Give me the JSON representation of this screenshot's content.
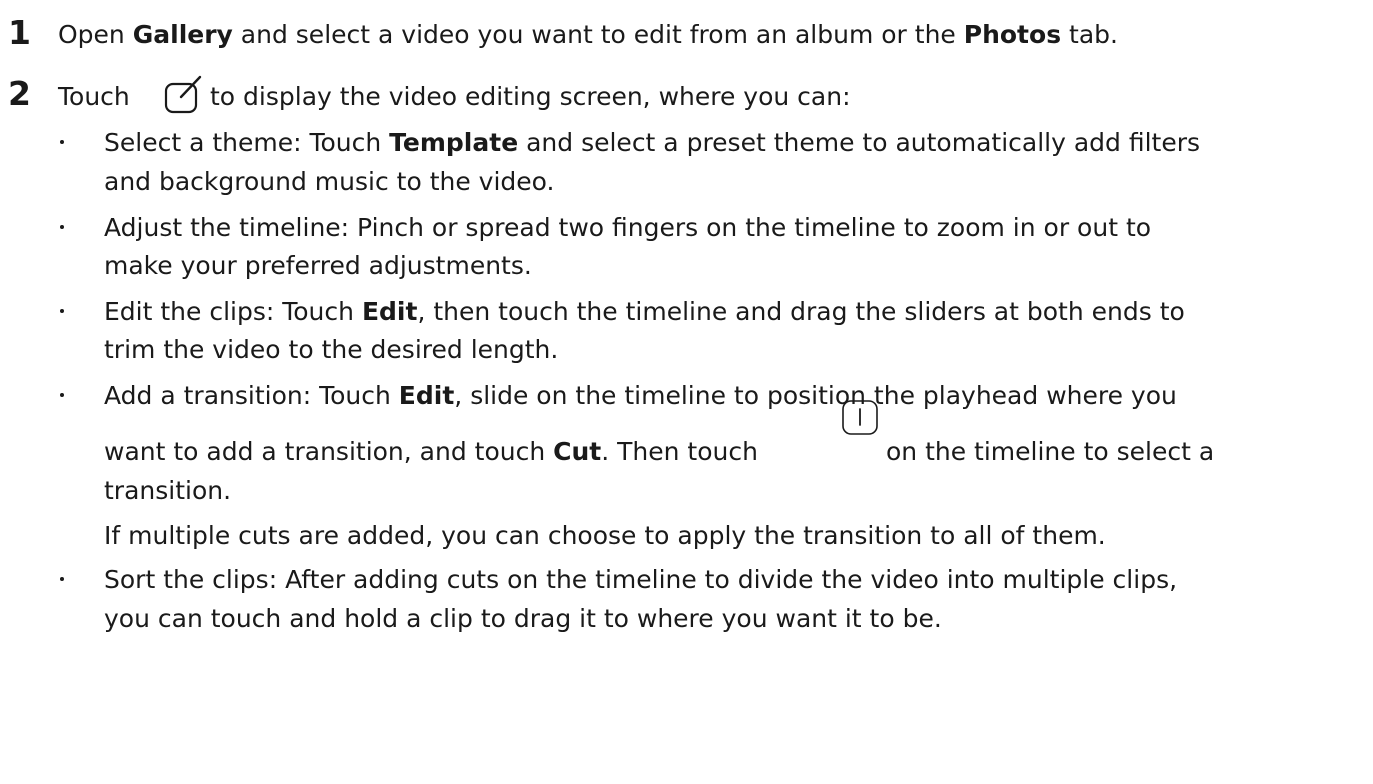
{
  "step1": {
    "number": "1",
    "t1": "Open ",
    "b1": "Gallery",
    "t2": " and select a video you want to edit from an album or the ",
    "b2": "Photos",
    "t3": " tab."
  },
  "step2": {
    "number": "2",
    "t1": "Touch ",
    "icon": "edit-square-icon",
    "t2": " to display the video editing screen, where you can:"
  },
  "bullets": {
    "theme": {
      "l1a": "Select a theme: Touch ",
      "l1b": "Template",
      "l1c": " and select a preset theme to automatically add filters",
      "l2": "and background music to the video."
    },
    "timeline": {
      "l1": "Adjust the timeline: Pinch or spread two fingers on the timeline to zoom in or out to",
      "l2": "make your preferred adjustments."
    },
    "clips": {
      "l1a": "Edit the clips: Touch ",
      "l1b": "Edit",
      "l1c": ", then touch the timeline and drag the sliders at both ends to",
      "l2": "trim the video to the desired length."
    },
    "transition": {
      "l1a": "Add a transition: Touch ",
      "l1b": "Edit",
      "l1c": ", slide on the timeline to position the playhead where you",
      "l2a": "want to add a transition, and touch ",
      "l2b": "Cut",
      "l2c": ". Then touch ",
      "icon": "transition-marker-icon",
      "l2d": " on the timeline to select a",
      "l3": "transition.",
      "l4": "If multiple cuts are added, you can choose to apply the transition to all of them."
    },
    "sort": {
      "l1": "Sort the clips: After adding cuts on the timeline to divide the video into multiple clips,",
      "l2": "you can touch and hold a clip to drag it to where you want it to be."
    }
  }
}
